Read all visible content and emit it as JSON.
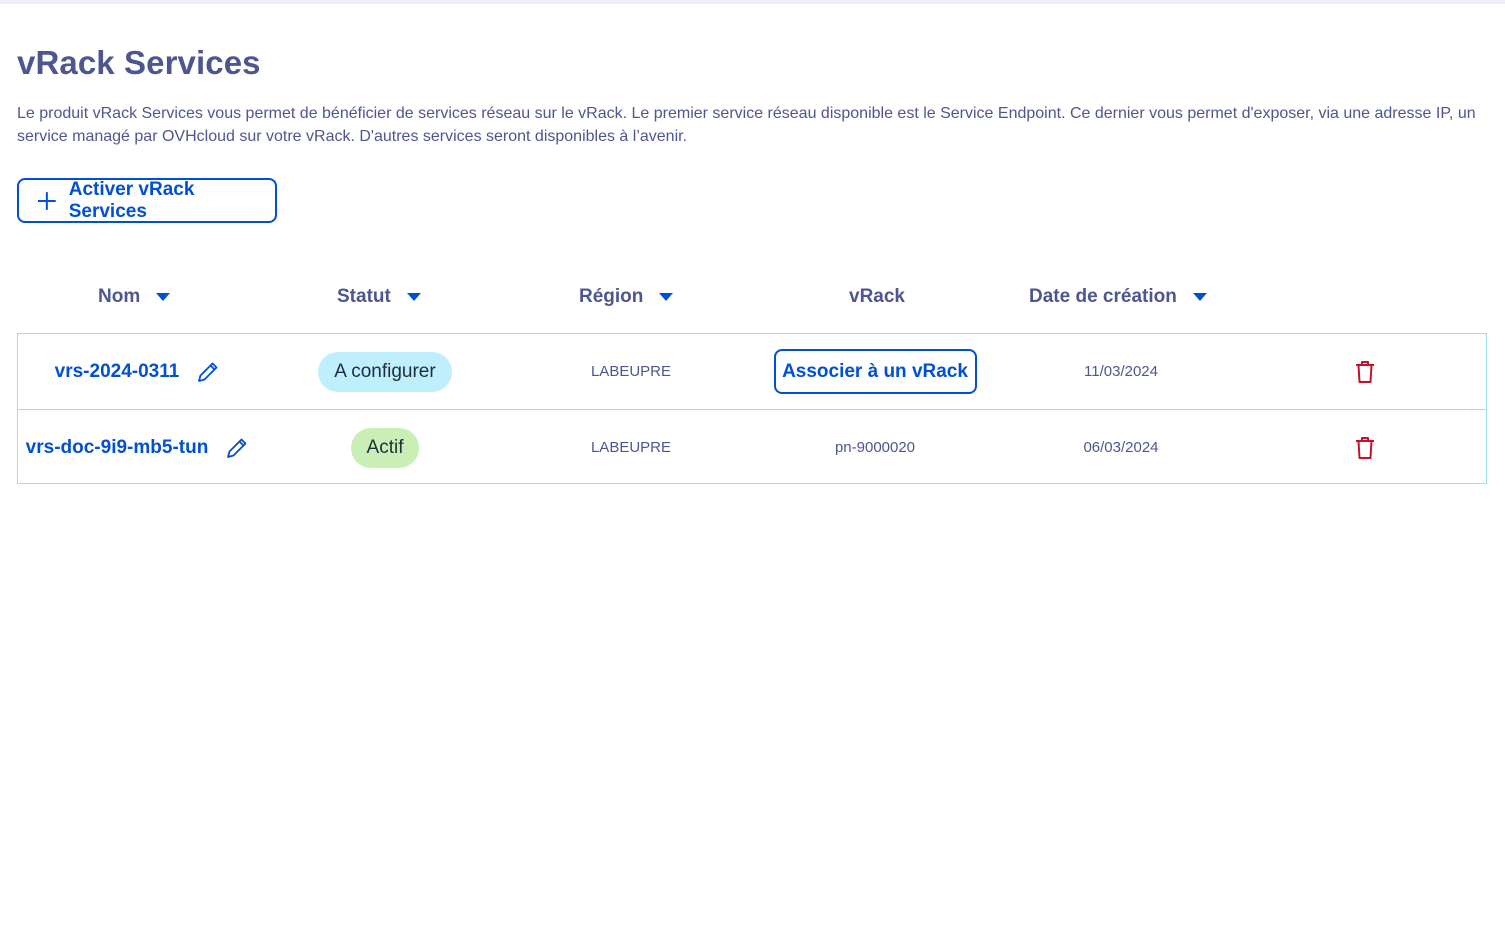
{
  "page": {
    "title": "vRack Services",
    "description": "Le produit vRack Services vous permet de bénéficier de services réseau sur le vRack. Le premier service réseau disponible est le Service Endpoint. Ce dernier vous permet d'exposer, via une adresse IP, un service managé par OVHcloud sur votre vRack. D'autres services seront disponibles à l’avenir."
  },
  "actions": {
    "activate_label": "Activer vRack Services"
  },
  "table": {
    "headers": {
      "name": "Nom",
      "status": "Statut",
      "region": "Région",
      "vrack": "vRack",
      "created": "Date de création"
    },
    "rows": [
      {
        "name": "vrs-2024-0311",
        "status": "A configurer",
        "region": "LABEUPRE",
        "vrack_action": "Associer à un vRack",
        "created": "11/03/2024"
      },
      {
        "name": "vrs-doc-9i9-mb5-tun",
        "status": "Actif",
        "region": "LABEUPRE",
        "vrack": "pn-9000020",
        "created": "06/03/2024"
      }
    ]
  },
  "colors": {
    "primary": "#0050d7",
    "heading": "#4d5693",
    "border": "#9fdde8",
    "badge_config": "#bfeefc",
    "badge_actif": "#c9efb7",
    "danger": "#c8102e"
  },
  "icons": {
    "activate": "plus-icon",
    "sort": "caret-down-icon",
    "edit": "pencil-icon",
    "delete": "trash-icon"
  }
}
